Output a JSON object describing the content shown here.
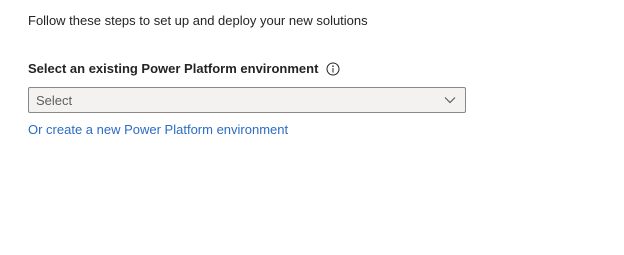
{
  "intro": {
    "text": "Follow these steps to set up and deploy your new solutions"
  },
  "environment_field": {
    "label": "Select an existing Power Platform environment",
    "info_icon": "info-icon",
    "select": {
      "value": "Select",
      "chevron_icon": "chevron-down-icon"
    }
  },
  "create_link": {
    "text": "Or create a new Power Platform environment",
    "color": "#2b6cc4"
  }
}
